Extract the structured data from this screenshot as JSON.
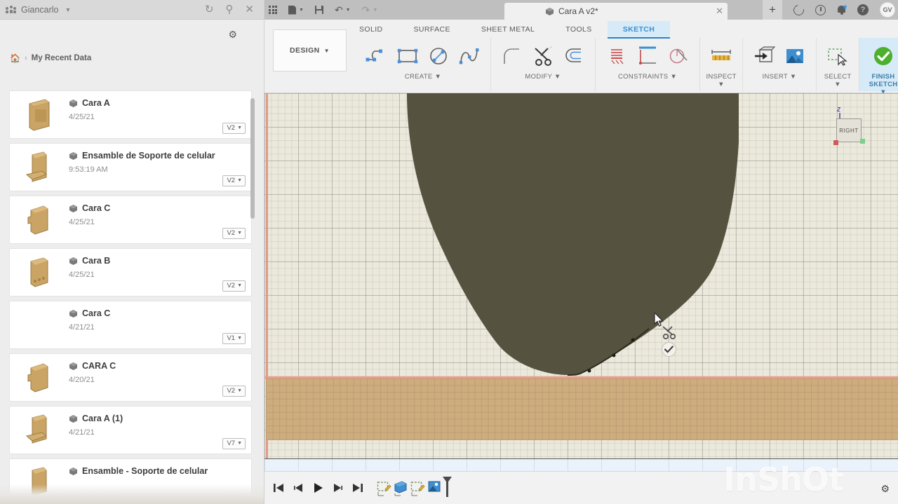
{
  "data_panel": {
    "hub_name": "Giancarlo",
    "hub_icon": "people-icon",
    "titlebar_icons": [
      "refresh-icon",
      "search-icon",
      "close-icon"
    ],
    "settings_icon": "gear-icon",
    "breadcrumb": {
      "home_icon": "home-icon",
      "separator": "›",
      "current": "My Recent Data"
    },
    "items": [
      {
        "name": "Cara A",
        "date": "4/25/21",
        "version": "V2",
        "thumb": "panel-part"
      },
      {
        "name": "Ensamble de Soporte de celular",
        "date": "9:53:19 AM",
        "version": "V2",
        "thumb": "assembly-part"
      },
      {
        "name": "Cara C",
        "date": "4/25/21",
        "version": "V2",
        "thumb": "notched-panel"
      },
      {
        "name": "Cara B",
        "date": "4/25/21",
        "version": "V2",
        "thumb": "slot-panel"
      },
      {
        "name": "Cara C",
        "date": "4/21/21",
        "version": "V1",
        "thumb": "none"
      },
      {
        "name": "CARA C",
        "date": "4/20/21",
        "version": "V2",
        "thumb": "notched-panel"
      },
      {
        "name": "Cara A (1)",
        "date": "4/21/21",
        "version": "V7",
        "thumb": "assembly-part"
      },
      {
        "name": "Ensamble - Soporte de celular",
        "date": "",
        "version": "",
        "thumb": "assembly-part"
      }
    ]
  },
  "fusion": {
    "tab": {
      "document_title": "Cara A v2*",
      "document_icon": "cube-icon",
      "close_icon": "close-icon",
      "left_tools": [
        "grid-icon",
        "new-document-icon",
        "save-icon",
        "undo-icon",
        "redo-icon"
      ],
      "right_icons": [
        "add-tab-icon",
        "job-status-icon",
        "recent-icon",
        "notifications-icon",
        "help-icon"
      ],
      "avatar_initials": "GV"
    },
    "ribbon": {
      "workspace": "DESIGN",
      "tabs": [
        {
          "label": "SOLID",
          "active": false
        },
        {
          "label": "SURFACE",
          "active": false
        },
        {
          "label": "SHEET METAL",
          "active": false
        },
        {
          "label": "TOOLS",
          "active": false
        },
        {
          "label": "SKETCH",
          "active": true
        }
      ],
      "panels": [
        {
          "label": "CREATE",
          "icons": [
            "line-icon",
            "rectangle-icon",
            "circle-icon",
            "spline-icon"
          ]
        },
        {
          "label": "MODIFY",
          "icons": [
            "fillet-icon",
            "trim-icon",
            "offset-icon"
          ]
        },
        {
          "label": "CONSTRAINTS",
          "icons": [
            "fix-icon",
            "perpendicular-icon",
            "tangent-icon"
          ]
        },
        {
          "label": "INSPECT",
          "icons": [
            "measure-icon"
          ]
        },
        {
          "label": "INSERT",
          "icons": [
            "insert-derive-icon",
            "insert-image-icon"
          ]
        },
        {
          "label": "SELECT",
          "icons": [
            "select-window-icon"
          ]
        }
      ],
      "finish": {
        "label": "FINISH SKETCH",
        "icon": "green-check-icon"
      }
    },
    "canvas": {
      "viewcube_face": "RIGHT",
      "viewcube_axis": "Z",
      "active_tool_cursor": "trim-cursor",
      "confirm_badge": "check-icon"
    },
    "timeline": {
      "controls": [
        "go-to-start-icon",
        "step-back-icon",
        "play-icon",
        "step-forward-icon",
        "go-to-end-icon"
      ],
      "features": [
        "sketch-feature-icon",
        "extrude-feature-icon",
        "sketch-feature-icon",
        "extrude-feature-icon"
      ],
      "settings_icon": "gear-icon"
    },
    "watermark": "InShOt"
  },
  "colors": {
    "accent_blue": "#2e82c9",
    "sketch_tab_bg": "#d6eaf7",
    "canvas_bg": "#ebe8dc",
    "body_tan": "#cdac7e",
    "sketch_fill": "#55523f",
    "axis_red": "#ec9d88",
    "green_check": "#4caf2e"
  }
}
